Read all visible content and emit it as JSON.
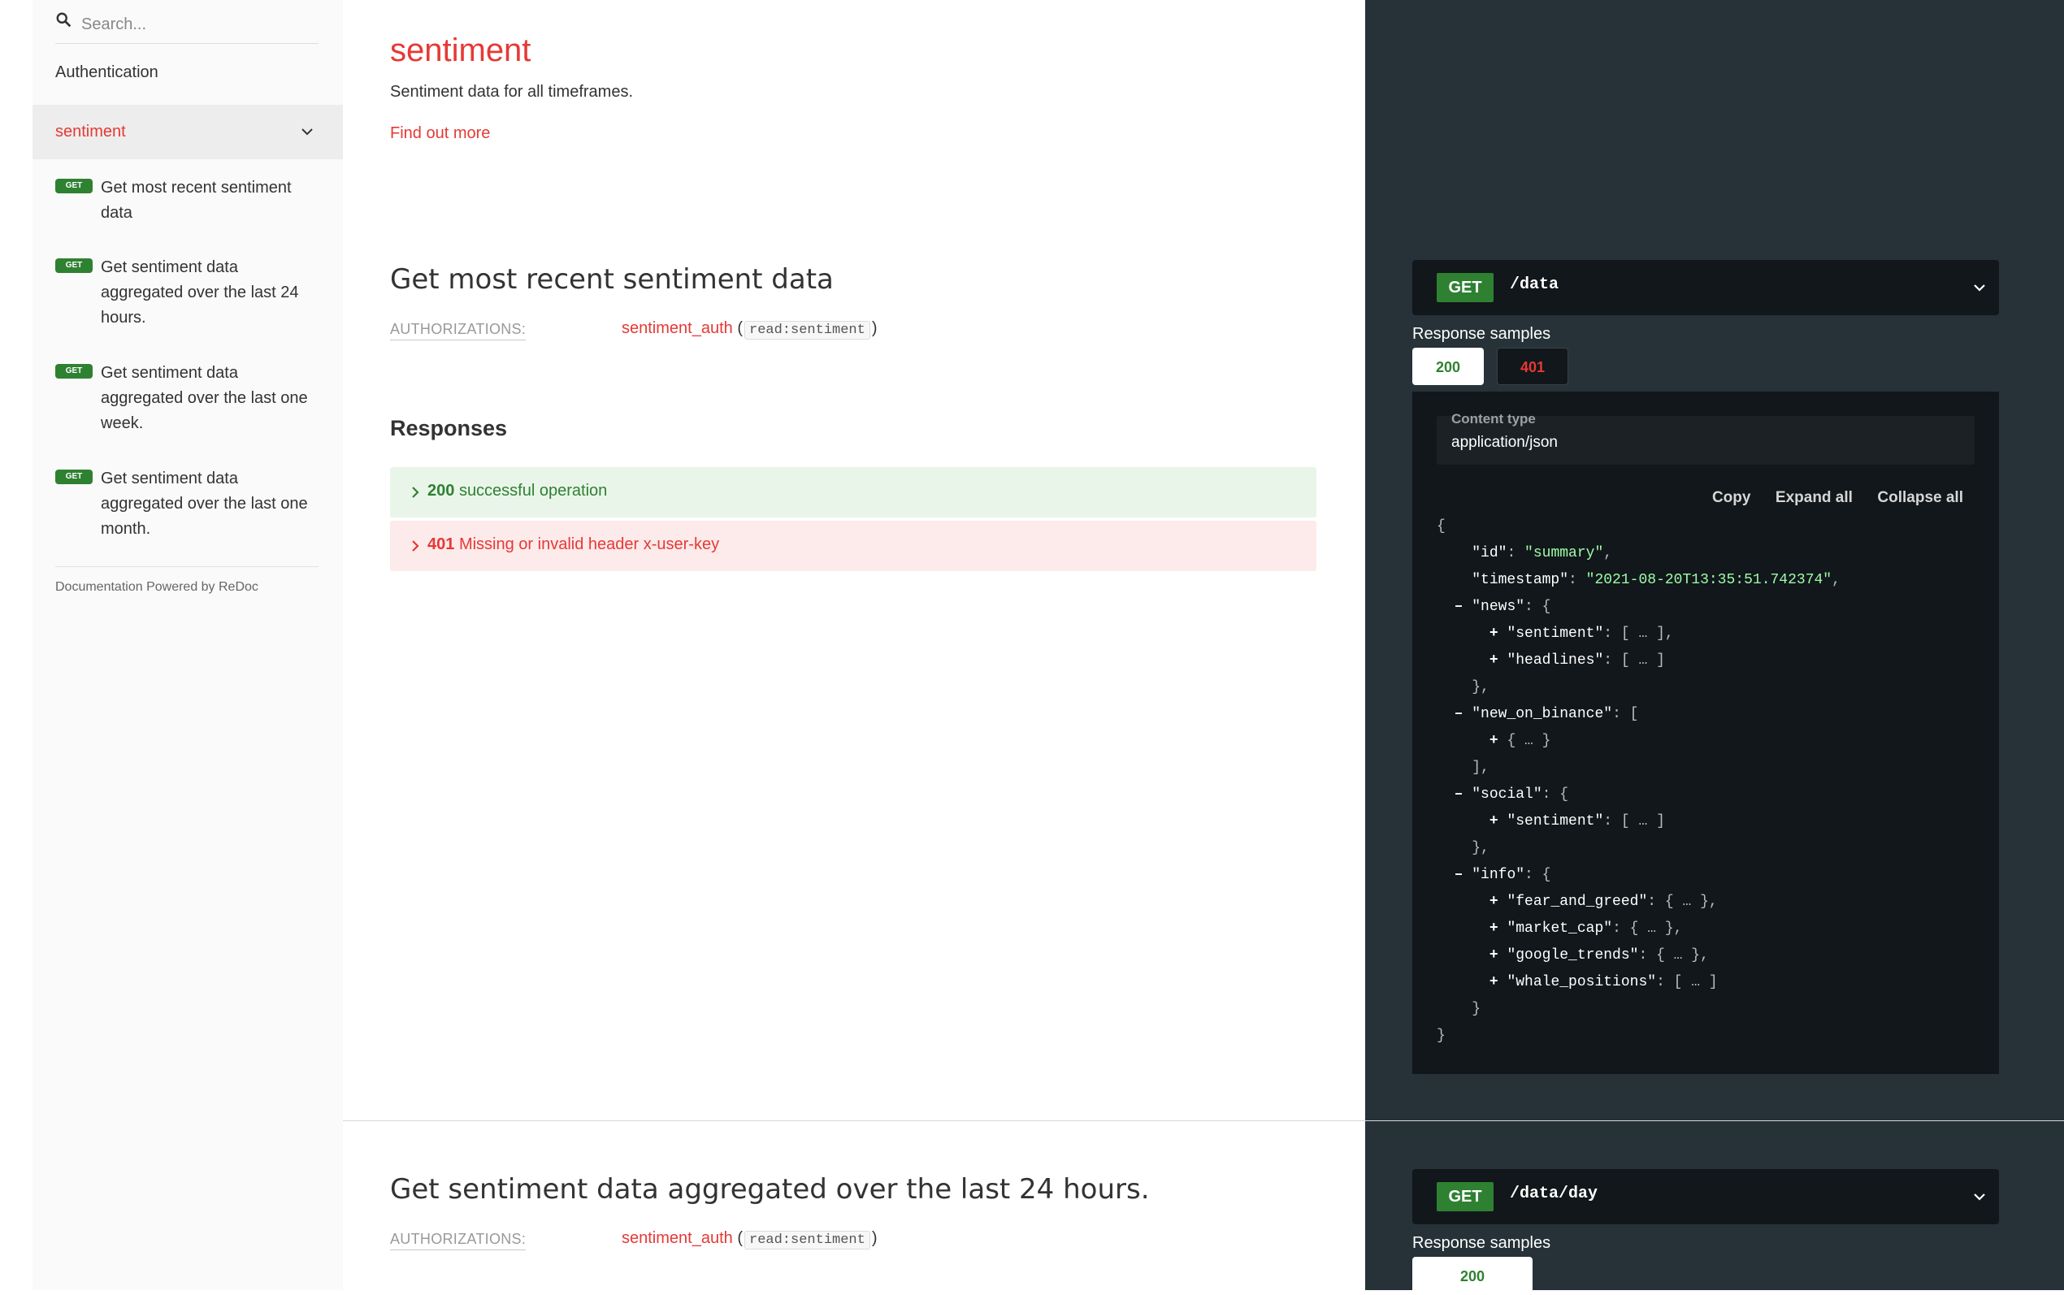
{
  "sidebar": {
    "search_placeholder": "Search...",
    "auth_label": "Authentication",
    "tag_label": "sentiment",
    "operations": [
      {
        "method": "GET",
        "label": "Get most recent sentiment data"
      },
      {
        "method": "GET",
        "label": "Get sentiment data aggregated over the last 24 hours."
      },
      {
        "method": "GET",
        "label": "Get sentiment data aggregated over the last one week."
      },
      {
        "method": "GET",
        "label": "Get sentiment data aggregated over the last one month."
      }
    ],
    "powered_by": "Documentation Powered by ReDoc"
  },
  "main": {
    "tag_title": "sentiment",
    "tag_description": "Sentiment data for all timeframes.",
    "find_out_more": "Find out more",
    "op1": {
      "title": "Get most recent sentiment data",
      "auth_label": "AUTHORIZATIONS:",
      "auth_name": "sentiment_auth",
      "auth_scope": "read:sentiment",
      "responses_heading": "Responses",
      "responses": [
        {
          "code": "200",
          "text": "successful operation"
        },
        {
          "code": "401",
          "text": "Missing or invalid header x-user-key"
        }
      ]
    },
    "op2": {
      "title": "Get sentiment data aggregated over the last 24 hours.",
      "auth_label": "AUTHORIZATIONS:",
      "auth_name": "sentiment_auth",
      "auth_scope": "read:sentiment"
    }
  },
  "right": {
    "ep1": {
      "method": "GET",
      "path": "/data"
    },
    "ep2": {
      "method": "GET",
      "path": "/data/day"
    },
    "response_samples": "Response samples",
    "tabs1": [
      "200",
      "401"
    ],
    "tabs2": [
      "200"
    ],
    "content_type_label": "Content type",
    "content_type_value": "application/json",
    "actions": {
      "copy": "Copy",
      "expand": "Expand all",
      "collapse": "Collapse all"
    },
    "json_sample": {
      "id_key": "\"id\"",
      "id_val": "\"summary\"",
      "ts_key": "\"timestamp\"",
      "ts_val": "\"2021-08-20T13:35:51.742374\"",
      "news_key": "\"news\"",
      "news_sentiment_key": "\"sentiment\"",
      "news_headlines_key": "\"headlines\"",
      "binance_key": "\"new_on_binance\"",
      "social_key": "\"social\"",
      "social_sentiment_key": "\"sentiment\"",
      "info_key": "\"info\"",
      "fg_key": "\"fear_and_greed\"",
      "mc_key": "\"market_cap\"",
      "gt_key": "\"google_trends\"",
      "wp_key": "\"whale_positions\""
    }
  },
  "colors": {
    "accent_red": "#e53935",
    "get_green": "#2f8132",
    "right_bg": "#263238",
    "code_bg": "#11171a",
    "string_green": "#a0fbaa"
  }
}
